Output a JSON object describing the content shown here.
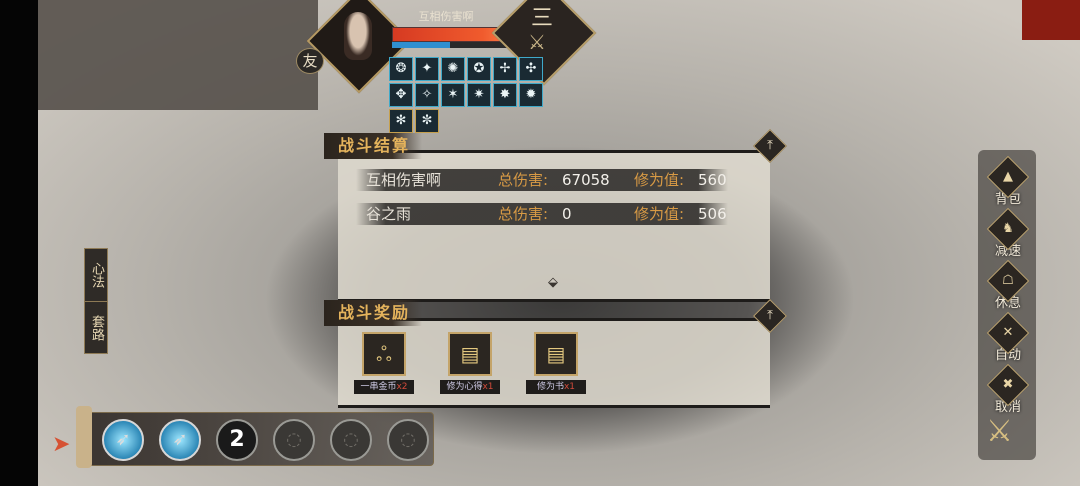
{
  "player": {
    "name": "互相伤害啊",
    "relation_badge": "友",
    "level_label": "三",
    "hp_fraction": 1.0,
    "mp_fraction": 0.45
  },
  "buff_icons": [
    "buff-icon-1",
    "buff-icon-2",
    "buff-icon-3",
    "buff-icon-4",
    "buff-icon-5",
    "buff-icon-6",
    "buff-icon-7",
    "buff-icon-8",
    "buff-icon-9",
    "buff-icon-10",
    "buff-icon-11",
    "buff-icon-12",
    "buff-icon-13",
    "buff-icon-14"
  ],
  "battle_result": {
    "title": "战斗结算",
    "rows": [
      {
        "name": "互相伤害啊",
        "damage_label": "总伤害:",
        "damage": "67058",
        "cultivation_label": "修为值:",
        "cultivation": "560"
      },
      {
        "name": "谷之雨",
        "damage_label": "总伤害:",
        "damage": "0",
        "cultivation_label": "修为值:",
        "cultivation": "506"
      }
    ]
  },
  "battle_rewards": {
    "title": "战斗奖励",
    "items": [
      {
        "name": "一串金币",
        "qty": "x2",
        "icon": "coin-string-icon"
      },
      {
        "name": "修为心得",
        "qty": "x1",
        "icon": "book-icon"
      },
      {
        "name": "修为书",
        "qty": "x1",
        "icon": "book-icon"
      }
    ]
  },
  "side_tabs": [
    "心法",
    "套路"
  ],
  "skills": [
    {
      "type": "active",
      "icon": "blade-icon",
      "label": ""
    },
    {
      "type": "active",
      "icon": "blade-icon",
      "label": ""
    },
    {
      "type": "num",
      "icon": "number-icon",
      "label": "2"
    },
    {
      "type": "empty",
      "icon": "empty-slot-icon",
      "label": ""
    },
    {
      "type": "empty",
      "icon": "empty-slot-icon",
      "label": ""
    },
    {
      "type": "empty",
      "icon": "empty-slot-icon",
      "label": ""
    }
  ],
  "right_menu": [
    {
      "label": "背包",
      "icon": "bag-icon"
    },
    {
      "label": "减速",
      "icon": "slow-icon"
    },
    {
      "label": "休息",
      "icon": "rest-icon"
    },
    {
      "label": "自动",
      "icon": "auto-icon"
    },
    {
      "label": "取消",
      "icon": "cancel-icon"
    }
  ],
  "colors": {
    "accent": "#e4b35c",
    "label_orange": "#d89a45",
    "hp": "#f05b2d",
    "mp": "#2f8fd0"
  }
}
